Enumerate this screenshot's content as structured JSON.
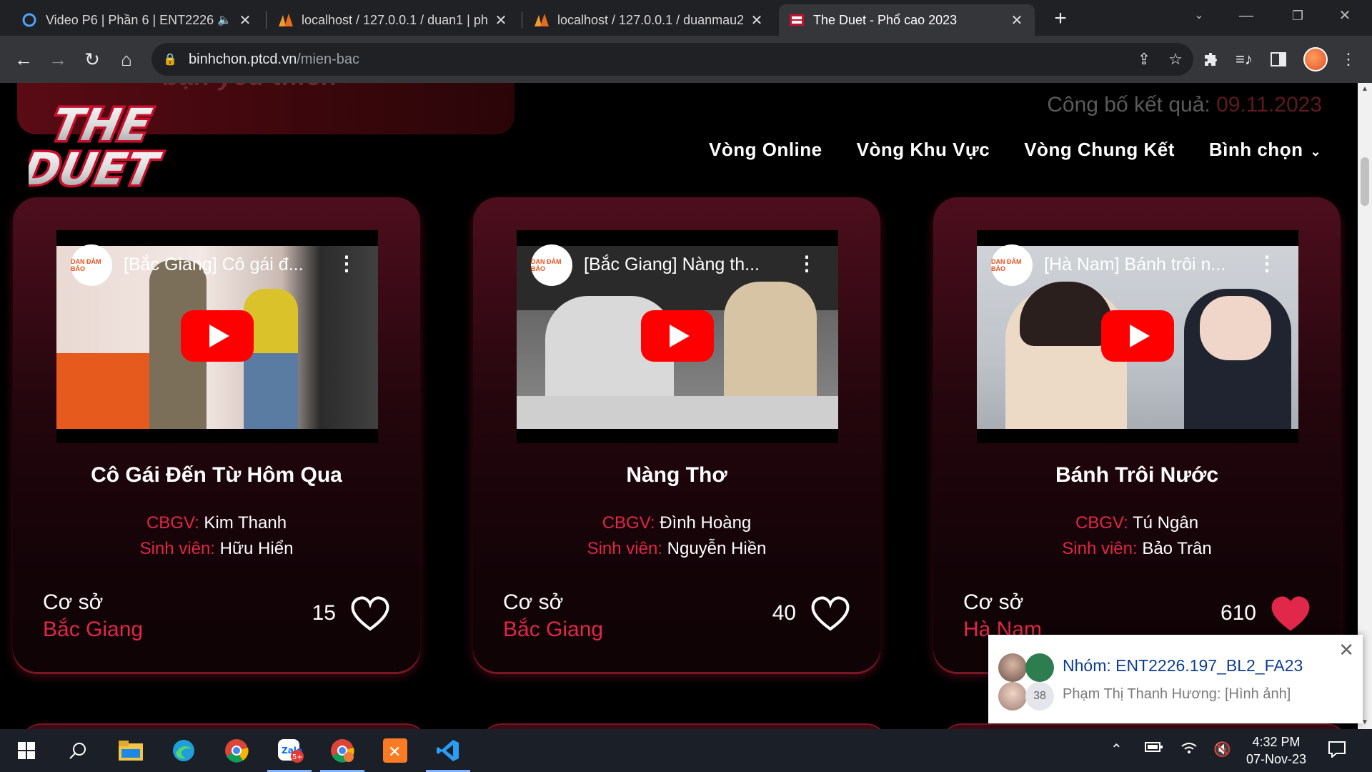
{
  "browser": {
    "tabs": [
      {
        "title": "Video P6 | Phần 6 | ENT2226",
        "icon": "circle-icon",
        "active": false
      },
      {
        "title": "localhost / 127.0.0.1 / duan1 | ph",
        "icon": "phpmyadmin-icon",
        "active": false
      },
      {
        "title": "localhost / 127.0.0.1 / duanmau2",
        "icon": "phpmyadmin-icon",
        "active": false
      },
      {
        "title": "The Duet - Phổ cao 2023",
        "icon": "theduet-icon",
        "active": true
      }
    ],
    "url_host": "binhchon.ptcd.vn",
    "url_path": "/mien-bac"
  },
  "page": {
    "banner_text": "bạn yêu thích",
    "logo_line1": "THE",
    "logo_line2": "DUET",
    "announce_label": "Công bố kết quả: ",
    "announce_date": "09.11.2023",
    "nav": [
      "Vòng Online",
      "Vòng Khu Vực",
      "Vòng Chung Kết",
      "Bình chọn"
    ],
    "credit_teacher_label": "CBGV: ",
    "credit_student_label": "Sinh viên: ",
    "campus_label": "Cơ sở",
    "cards": [
      {
        "video_title": "[Bắc Giang] Cô gái đ...",
        "title": "Cô Gái Đến Từ Hôm Qua",
        "teacher": "Kim Thanh",
        "student": "Hữu Hiển",
        "campus": "Bắc Giang",
        "votes": "15",
        "liked": false
      },
      {
        "video_title": "[Bắc Giang] Nàng th...",
        "title": "Nàng Thơ",
        "teacher": "Đình Hoàng",
        "student": "Nguyễn Hiền",
        "campus": "Bắc Giang",
        "votes": "40",
        "liked": false
      },
      {
        "video_title": "[Hà Nam] Bánh trôi n...",
        "title": "Bánh Trôi Nước",
        "teacher": "Tú Ngân",
        "student": "Bảo Trân",
        "campus": "Hà Nam",
        "votes": "610",
        "liked": true
      }
    ],
    "channel_badge": "DAN ĐẢM BẢO",
    "accent_color": "#e1274a"
  },
  "notification": {
    "group": "Nhóm: ENT2226.197_BL2_FA23",
    "message": "Phạm Thị Thanh Hương: [Hình ảnh]",
    "member_count": "38"
  },
  "taskbar": {
    "time": "4:32 PM",
    "date": "07-Nov-23",
    "zalo_badge": "5+"
  }
}
